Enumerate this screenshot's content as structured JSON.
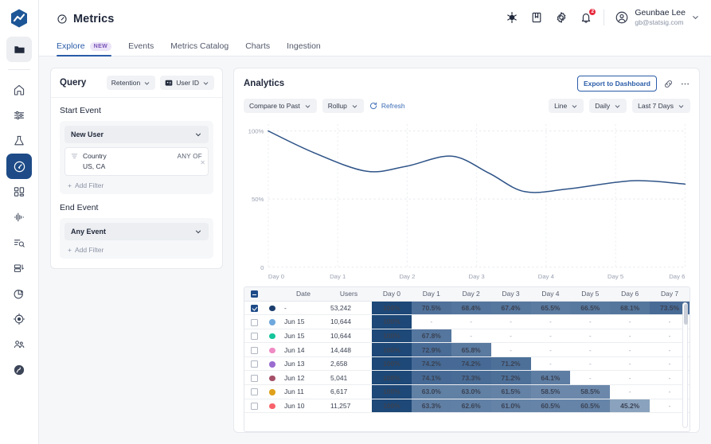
{
  "rail": {
    "logo_name": "statsig-logo",
    "folder_icon": "folder-icon",
    "items": [
      {
        "name": "home-icon",
        "label": "Home"
      },
      {
        "name": "sliders-icon",
        "label": "Feature Gates"
      },
      {
        "name": "flask-icon",
        "label": "Experiments"
      },
      {
        "name": "gauge-icon",
        "label": "Metrics",
        "active": true
      },
      {
        "name": "grid-icon",
        "label": "Dashboards"
      },
      {
        "name": "pulse-icon",
        "label": "Diagnostics"
      },
      {
        "name": "list-search-icon",
        "label": "Logs"
      },
      {
        "name": "tag-icon",
        "label": "Tags"
      },
      {
        "name": "pie-chart-icon",
        "label": "Analytics"
      },
      {
        "name": "target-icon",
        "label": "Targeting"
      },
      {
        "name": "people-icon",
        "label": "Users"
      },
      {
        "name": "globe-icon",
        "label": "Integrations"
      }
    ]
  },
  "header": {
    "page_icon": "gauge-icon",
    "title": "Metrics",
    "icons": [
      {
        "name": "bug-icon"
      },
      {
        "name": "book-icon"
      },
      {
        "name": "gear-icon"
      },
      {
        "name": "bell-icon",
        "badge": "2"
      }
    ],
    "user": {
      "avatar_icon": "user-avatar-icon",
      "name": "Geunbae Lee",
      "email": "gb@statsig.com",
      "chevron_icon": "chevron-down-icon"
    },
    "tabs": [
      {
        "label": "Explore",
        "badge": "NEW",
        "active": true
      },
      {
        "label": "Events",
        "badge": null,
        "active": false
      },
      {
        "label": "Metrics Catalog",
        "badge": null,
        "active": false
      },
      {
        "label": "Charts",
        "badge": null,
        "active": false
      },
      {
        "label": "Ingestion",
        "badge": null,
        "active": false
      }
    ]
  },
  "query": {
    "title": "Query",
    "pills": [
      {
        "label": "Retention",
        "icon": null,
        "chevron": "chevron-down-icon"
      },
      {
        "label": "User ID",
        "icon": "id-card-icon",
        "chevron": "chevron-down-icon"
      }
    ],
    "start_event": {
      "section_label": "Start Event",
      "select_value": "New User",
      "filter": {
        "icon": "funnel-icon",
        "name": "Country",
        "operator": "ANY OF",
        "value": "US, CA",
        "remove_icon": "close-icon"
      },
      "add_filter_label": "Add Filter"
    },
    "end_event": {
      "section_label": "End Event",
      "select_value": "Any Event",
      "add_filter_label": "Add Filter"
    }
  },
  "analytics": {
    "title": "Analytics",
    "export_label": "Export to Dashboard",
    "link_icon": "link-icon",
    "more_icon": "ellipsis-icon",
    "tools_left": [
      {
        "label": "Compare to Past",
        "icon": null,
        "chevron": true
      },
      {
        "label": "Rollup",
        "icon": null,
        "chevron": true
      },
      {
        "label": "Refresh",
        "icon": "refresh-icon",
        "chevron": false,
        "style": "link"
      }
    ],
    "tools_right": [
      {
        "label": "Line",
        "chevron": true
      },
      {
        "label": "Daily",
        "chevron": true
      },
      {
        "label": "Last 7 Days",
        "chevron": true
      }
    ]
  },
  "chart_data": {
    "type": "line",
    "title": "",
    "xlabel": "",
    "ylabel": "",
    "x": [
      "Day 0",
      "Day 1",
      "Day 2",
      "Day 3",
      "Day 4",
      "Day 5",
      "Day 6"
    ],
    "ytick_labels": [
      "100%",
      "50%",
      "0"
    ],
    "ytick_values": [
      100,
      50,
      0
    ],
    "ylim": [
      0,
      105
    ],
    "grid": true,
    "legend": "none",
    "line_color": "#2f5488",
    "series": [
      {
        "name": "Retention",
        "values": [
          100,
          84,
          70.5,
          74,
          81.5,
          69,
          55.5,
          57.5,
          63.5,
          61
        ],
        "x_fraction": [
          0,
          0.11,
          0.235,
          0.33,
          0.44,
          0.53,
          0.615,
          0.72,
          0.875,
          1.0
        ]
      }
    ]
  },
  "table": {
    "columns": [
      "",
      "",
      "Date",
      "Users",
      "Day 0",
      "Day 1",
      "Day 2",
      "Day 3",
      "Day 4",
      "Day 5",
      "Day 6",
      "Day 7"
    ],
    "header_checkbox_state": "indeterminate",
    "rows": [
      {
        "checked": true,
        "color": "#1d3f6e",
        "date": "-",
        "users": "53,242",
        "cells": [
          "100%",
          "70.5%",
          "68.4%",
          "67.4%",
          "65.5%",
          "66.5%",
          "68.1%",
          "73.5%"
        ]
      },
      {
        "checked": false,
        "color": "#6fa8dc",
        "date": "Jun 15",
        "users": "10,644",
        "cells": [
          "100%",
          "-",
          "-",
          "-",
          "-",
          "-",
          "-",
          "-"
        ]
      },
      {
        "checked": false,
        "color": "#14c49b",
        "date": "Jun 15",
        "users": "10,644",
        "cells": [
          "100%",
          "67.8%",
          "-",
          "-",
          "-",
          "-",
          "-",
          "-"
        ]
      },
      {
        "checked": false,
        "color": "#ef8bc4",
        "date": "Jun 14",
        "users": "14,448",
        "cells": [
          "100%",
          "72.9%",
          "65.8%",
          "-",
          "-",
          "-",
          "-",
          "-"
        ]
      },
      {
        "checked": false,
        "color": "#9b6cd0",
        "date": "Jun 13",
        "users": "2,658",
        "cells": [
          "100%",
          "74.2%",
          "74.2%",
          "71.2%",
          "-",
          "-",
          "-",
          "-"
        ]
      },
      {
        "checked": false,
        "color": "#a55068",
        "date": "Jun 12",
        "users": "5,041",
        "cells": [
          "100%",
          "74.1%",
          "73.3%",
          "71.2%",
          "64.1%",
          "-",
          "-",
          "-"
        ]
      },
      {
        "checked": false,
        "color": "#dfa01b",
        "date": "Jun 11",
        "users": "6,617",
        "cells": [
          "100%",
          "63.0%",
          "63.0%",
          "61.5%",
          "58.5%",
          "58.5%",
          "-",
          "-"
        ]
      },
      {
        "checked": false,
        "color": "#f8626b",
        "date": "Jun 10",
        "users": "11,257",
        "cells": [
          "100%",
          "63.3%",
          "62.6%",
          "61.0%",
          "60.5%",
          "60.5%",
          "45.2%",
          "-"
        ]
      }
    ]
  },
  "colors": {
    "accent": "#2a5ca8",
    "heat_full": "#1d4877",
    "heat_mid": "#4a6f9b",
    "heat_light": "#7e9bbd",
    "badge_red": "#e8273c",
    "badge_purple_bg": "#ece4f8",
    "badge_purple_fg": "#7a55b8"
  }
}
